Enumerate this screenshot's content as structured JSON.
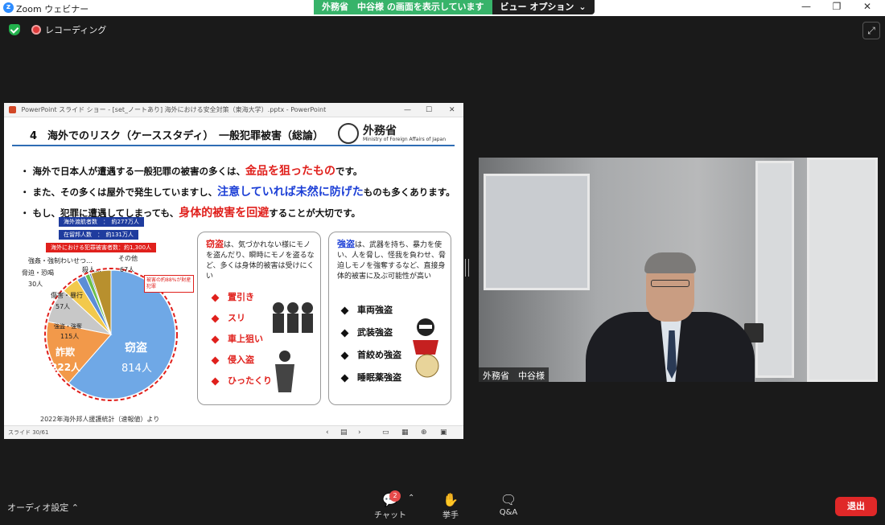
{
  "app": {
    "title": "Zoom ウェビナー",
    "share_banner": "外務省　中谷様 の画面を表示しています",
    "view_option": "ビュー オプション"
  },
  "window_controls": {
    "minimize": "—",
    "restore": "❐",
    "close": "✕"
  },
  "recording": {
    "label": "レコーディング"
  },
  "ppt_window": {
    "title": "PowerPoint スライド ショー - [set_ノートあり] 海外における安全対策（東海大学）.pptx - PowerPoint",
    "status": "スライド 30/61"
  },
  "slide": {
    "heading": "4　海外でのリスク（ケーススタディ）　一般犯罪被害（総論）",
    "ministry_jp": "外務省",
    "ministry_en": "Ministry of Foreign Affairs of Japan",
    "bullets": [
      {
        "pre": "・ 海外で日本人が遭遇する一般犯罪の被害の多くは、",
        "hl": "金品を狙ったもの",
        "post": "です。"
      },
      {
        "pre": "・ また、その多くは屋外で発生していますし、",
        "hl": "注意していれば未然に防げた",
        "post": "ものも多くあります。"
      },
      {
        "pre": "・ もし、犯罪に遭遇してしまっても、",
        "hl": "身体的被害を回避",
        "post": "することが大切です。"
      }
    ],
    "stats": [
      {
        "text": "海外渡航者数　：　約277万人"
      },
      {
        "text": "在留邦人数　：　約131万人"
      },
      {
        "text": "海外における犯罪被害者数：約1,300人"
      }
    ],
    "callout": "被害の約88%が財産犯罪",
    "pie_labels": {
      "theft_name": "窃盗",
      "theft_value": "814人",
      "fraud_name": "詐欺",
      "fraud_value": "222人",
      "robbery": "強盗・強奪",
      "robbery_value": "115人",
      "injury": "傷害・暴行",
      "injury_value": "57人",
      "threat": "脅迫・恐喝",
      "threat_value": "30人",
      "sexual": "強姦・強制わいせつ…",
      "murder": "殺人…",
      "other": "その他",
      "other_value": "67人"
    },
    "panel_theft": {
      "title": "窃盗",
      "desc": "は、気づかれない様にモノを盗んだり、瞬時にモノを盗るなど、多くは身体的被害は受けにくい",
      "items": [
        "置引き",
        "スリ",
        "車上狙い",
        "侵入盗",
        "ひったくり"
      ]
    },
    "panel_robbery": {
      "title": "強盗",
      "desc": "は、武器を持ち、暴力を使い、人を脅し、怪我を負わせ、脅迫しモノを強奪するなど、直接身体的被害に及ぶ可能性が高い",
      "items": [
        "車両強盗",
        "武装強盗",
        "首絞め強盗",
        "睡眠薬強盗"
      ]
    },
    "source": "2022年海外邦人援護統計（速報値）より"
  },
  "video": {
    "name": "外務省　中谷様"
  },
  "bottom": {
    "audio": "オーディオ設定",
    "chat": "チャット",
    "chat_badge": "2",
    "raise_hand": "挙手",
    "qa": "Q&A",
    "leave": "退出"
  },
  "chart_data": {
    "type": "pie",
    "title": "",
    "categories": [
      "窃盗",
      "詐欺",
      "強盗・強奪",
      "傷害・暴行",
      "脅迫・恐喝",
      "強姦・強制わいせつ…",
      "殺人…",
      "その他"
    ],
    "values": [
      814,
      222,
      115,
      57,
      30,
      15,
      5,
      67
    ],
    "colors": [
      "#6fa8e6",
      "#f2994a",
      "#c8c8c8",
      "#f2c94c",
      "#5b8dd6",
      "#6abf4b",
      "#2f5fa8",
      "#b8902e"
    ]
  }
}
